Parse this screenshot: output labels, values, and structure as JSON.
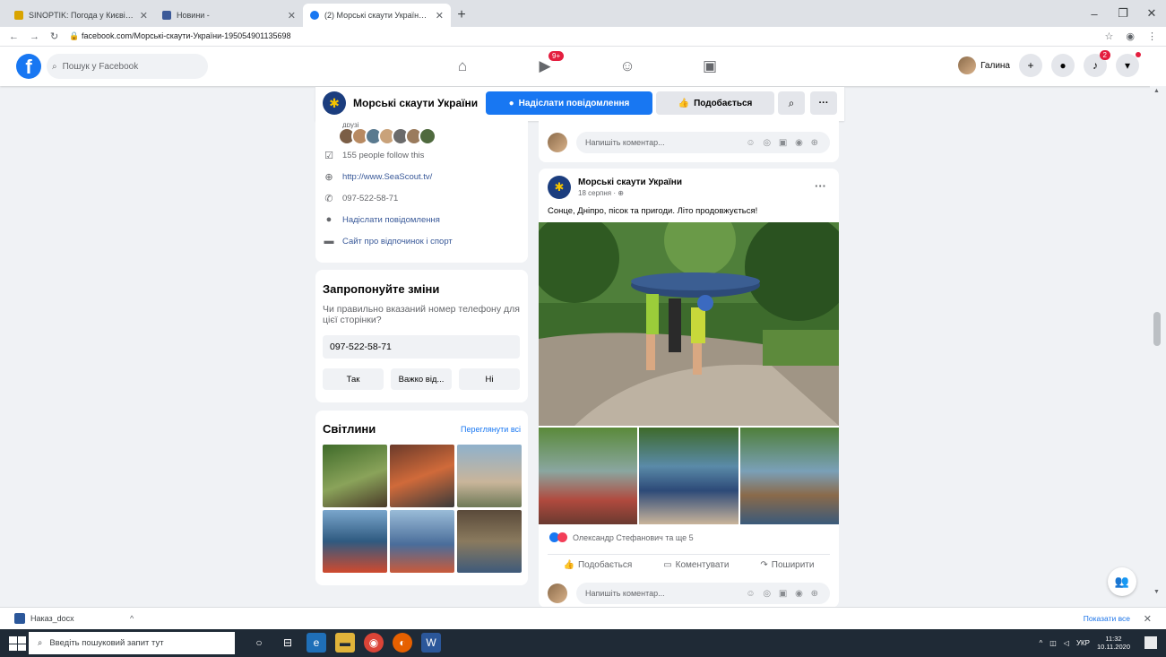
{
  "browser": {
    "tabs": [
      {
        "title": "SINOPTIK: Погода у Києві на ?",
        "icon_color": "#d9a400",
        "active": false
      },
      {
        "title": "Новини -",
        "icon_color": "#3b5998",
        "active": false
      },
      {
        "title": "(2) Морські скаути України (Fa",
        "icon_color": "#1877f2",
        "active": true
      }
    ],
    "url_host": "facebook.com",
    "url_path": "/Морські-скаути-України-195054901135698"
  },
  "fb_header": {
    "search_placeholder": "Пошук у Facebook",
    "watch_badge": "9+",
    "user_name": "Галина",
    "notifications_badge": "2"
  },
  "page_bar": {
    "page_name": "Морські скаути України",
    "message_button": "Надіслати повідомлення",
    "like_button": "Подобається"
  },
  "about": {
    "followers_label": "друзі",
    "followers": "155 people follow this",
    "website": "http://www.SeaScout.tv/",
    "phone": "097-522-58-71",
    "send_message": "Надіслати повідомлення",
    "category": "Сайт про відпочинок і спорт"
  },
  "suggest": {
    "title": "Запропонуйте зміни",
    "question": "Чи правильно вказаний номер телефону для цієї сторінки?",
    "phone": "097-522-58-71",
    "answers": [
      "Так",
      "Важко від...",
      "Ні"
    ]
  },
  "photos": {
    "title": "Світлини",
    "see_all": "Переглянути всі",
    "tiles": [
      "#5f7a3a",
      "#b04a2e",
      "#6e8fa8",
      "#2f5a80",
      "#4a6d9a",
      "#6a5a3e"
    ]
  },
  "feed": {
    "comment_placeholder": "Напишіть коментар...",
    "comment_icons": "☺ ◎ ▣ ◉ ⊕",
    "post": {
      "author": "Морські скаути України",
      "date": "18 серпня ·",
      "text": "Сонце, Дніпро, пісок та пригоди. Літо продовжується!",
      "reactions": "Олександр Стефанович та ще 5",
      "actions": [
        "Подобається",
        "Коментувати",
        "Поширити"
      ]
    }
  },
  "downloads": {
    "file": "Наказ_docx",
    "show_all": "Показати все"
  },
  "taskbar": {
    "search_placeholder": "Введіть пошуковий запит тут",
    "lang": "УКР",
    "time": "11:32",
    "date": "10.11.2020"
  }
}
